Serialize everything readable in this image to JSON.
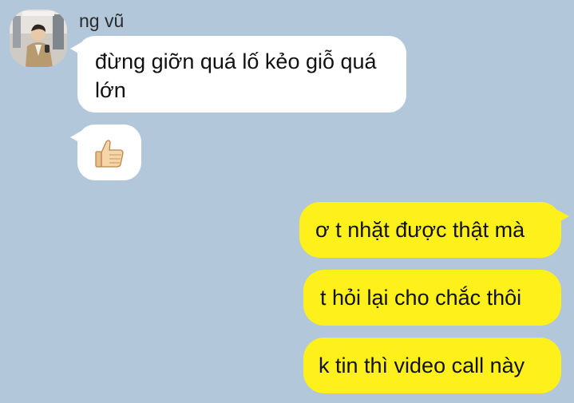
{
  "sender": {
    "name": "ng vũ",
    "avatar_icon": "profile-photo"
  },
  "messages": [
    {
      "direction": "incoming",
      "type": "text",
      "text": "đừng giỡn quá lố kẻo giỗ quá lớn"
    },
    {
      "direction": "incoming",
      "type": "emoji",
      "icon": "thumbs-up-icon"
    },
    {
      "direction": "outgoing",
      "type": "text",
      "text": "ơ t nhặt được thật mà"
    },
    {
      "direction": "outgoing",
      "type": "text",
      "text": "t hỏi lại cho chắc thôi"
    },
    {
      "direction": "outgoing",
      "type": "text",
      "text": "k tin thì video call này"
    }
  ],
  "colors": {
    "background": "#b2c7da",
    "incoming_bubble": "#ffffff",
    "outgoing_bubble": "#fef01b",
    "text": "#111111"
  }
}
